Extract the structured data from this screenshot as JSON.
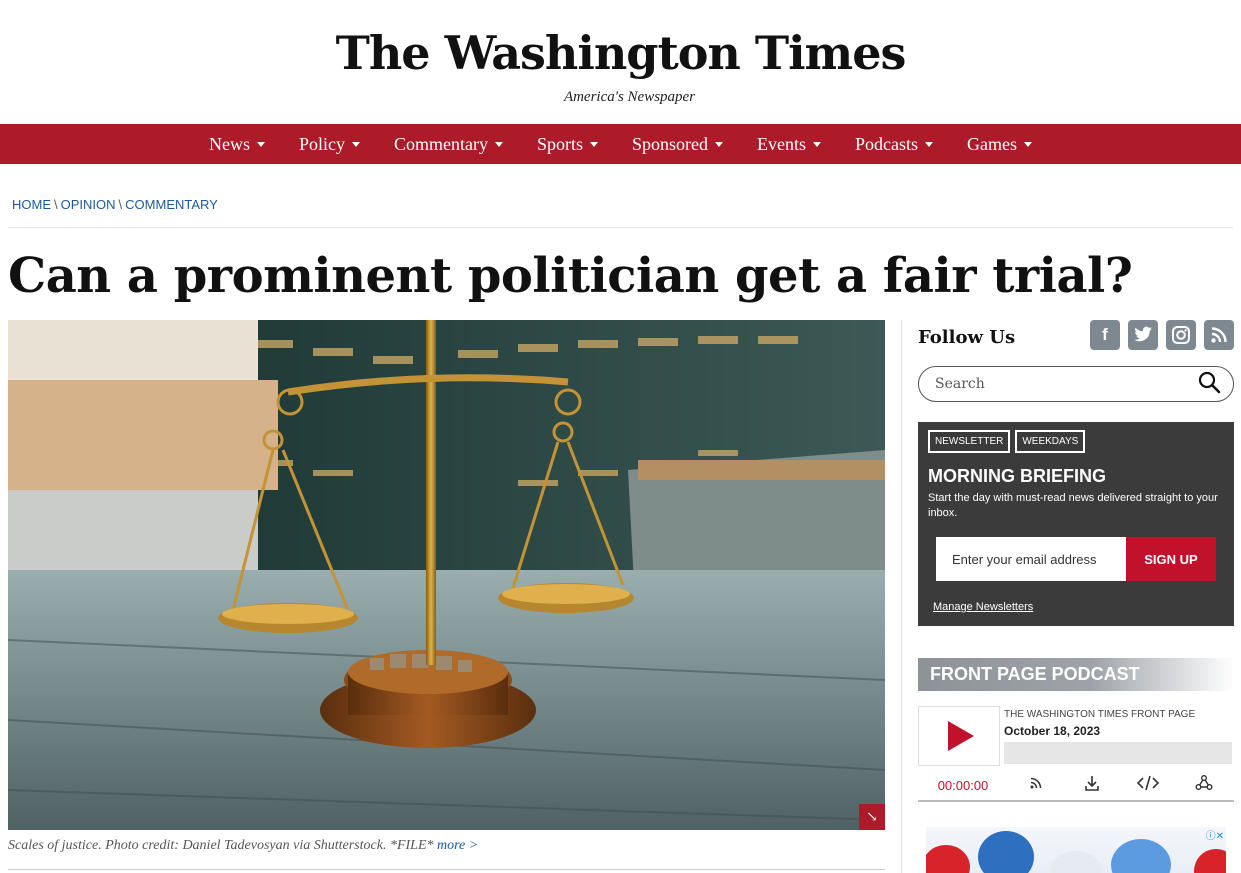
{
  "masthead": {
    "logo": "The Washington Times",
    "tagline": "America's Newspaper"
  },
  "nav": {
    "items": [
      {
        "label": "News"
      },
      {
        "label": "Policy"
      },
      {
        "label": "Commentary"
      },
      {
        "label": "Sports"
      },
      {
        "label": "Sponsored"
      },
      {
        "label": "Events"
      },
      {
        "label": "Podcasts"
      },
      {
        "label": "Games"
      }
    ]
  },
  "breadcrumb": {
    "home": "HOME",
    "opinion": "OPINION",
    "commentary": "COMMENTARY",
    "separator": "\\"
  },
  "article": {
    "headline": "Can a prominent politician get a fair trial?",
    "caption": "Scales of justice. Photo credit: Daniel Tadevosyan via Shutterstock. *FILE* ",
    "caption_more": "more >"
  },
  "sidebar": {
    "follow_label": "Follow Us",
    "social": [
      {
        "icon": "facebook-icon",
        "glyph": "f"
      },
      {
        "icon": "twitter-icon",
        "glyph": "t"
      },
      {
        "icon": "instagram-icon",
        "glyph": "◎"
      },
      {
        "icon": "rss-icon",
        "glyph": ")"
      }
    ],
    "search_placeholder": "Search"
  },
  "newsletter": {
    "tags": [
      "NEWSLETTER",
      "WEEKDAYS"
    ],
    "title": "MORNING BRIEFING",
    "description": "Start the day with must-read news delivered straight to your inbox.",
    "email_placeholder": "Enter your email address",
    "signup_label": "SIGN UP",
    "manage_label": "Manage Newsletters"
  },
  "podcast": {
    "section_title": "FRONT PAGE PODCAST",
    "show": "THE WASHINGTON TIMES FRONT PAGE",
    "date": "October 18, 2023",
    "time": "00:00:00"
  },
  "colors": {
    "brand_red": "#ad1b2a",
    "link_blue": "#1a5a9c",
    "newsletter_bg": "#3b3b3b"
  }
}
